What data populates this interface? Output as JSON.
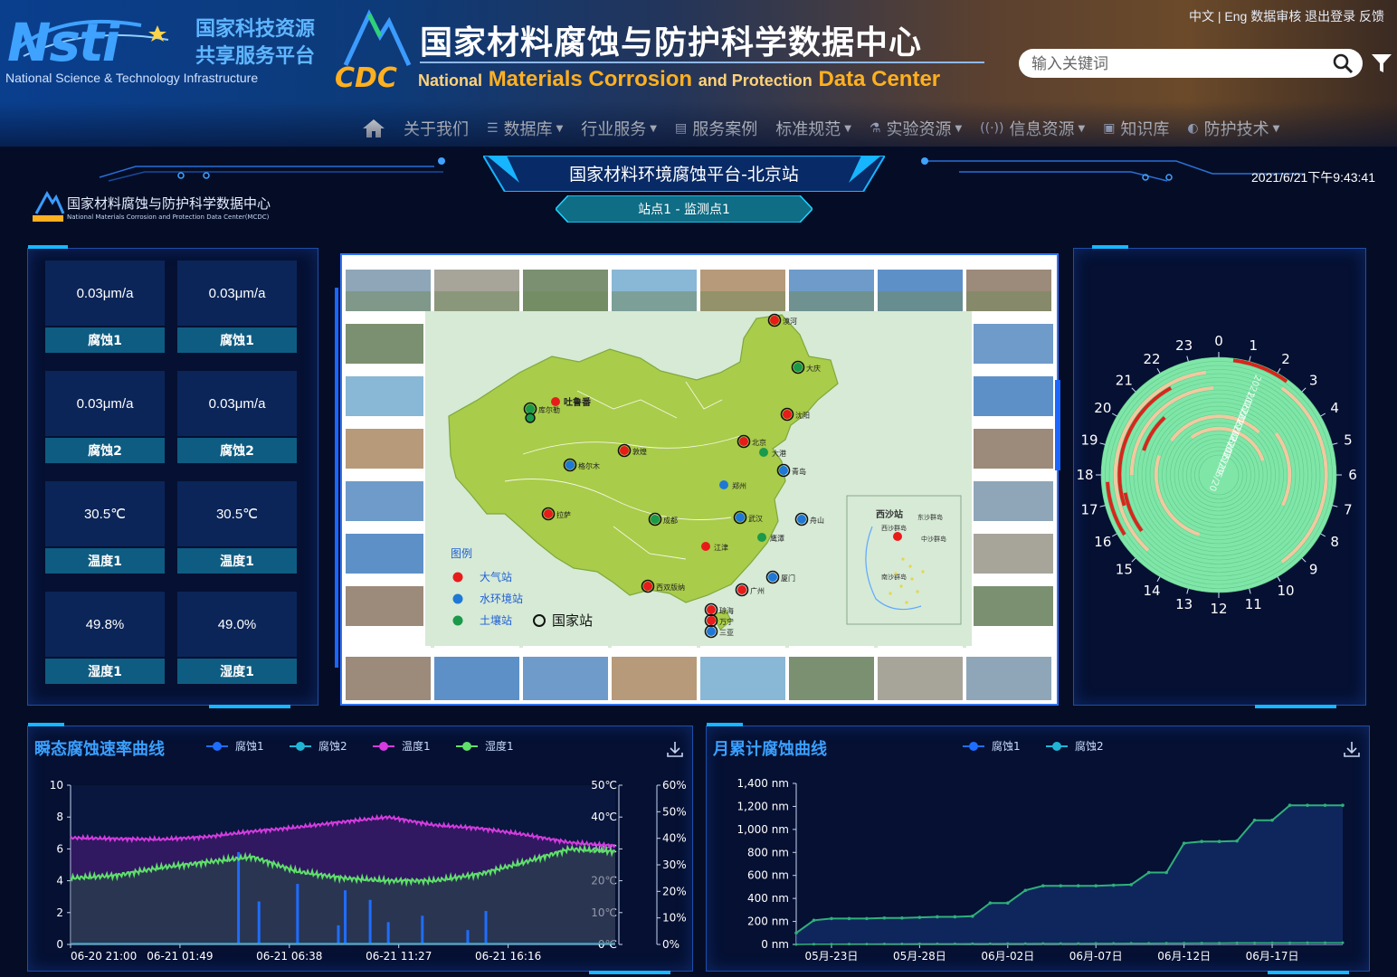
{
  "header": {
    "nsti_logo_text": "Nsti",
    "nsti_subtitle": "National Science & Technology Infrastructure",
    "platform_line1": "国家科技资源",
    "platform_line2": "共享服务平台",
    "cdc_logo_text": "CDC",
    "main_title": "国家材料腐蚀与防护科学数据中心",
    "en_title_1": "National",
    "en_title_2": "Materials Corrosion",
    "en_title_3": "and Protection",
    "en_title_4": "Data Center",
    "top_links": "中文 | Eng 数据审核 退出登录 反馈",
    "search_placeholder": "输入关键词"
  },
  "nav": [
    {
      "label": "关于我们",
      "icon": "",
      "caret": false
    },
    {
      "label": "数据库",
      "icon": "database-icon",
      "caret": true
    },
    {
      "label": "行业服务",
      "icon": "",
      "caret": true
    },
    {
      "label": "服务案例",
      "icon": "list-icon",
      "caret": false
    },
    {
      "label": "标准规范",
      "icon": "",
      "caret": true
    },
    {
      "label": "实验资源",
      "icon": "flask-icon",
      "caret": true
    },
    {
      "label": "信息资源",
      "icon": "broadcast-icon",
      "caret": true
    },
    {
      "label": "知识库",
      "icon": "book-icon",
      "caret": false
    },
    {
      "label": "防护技术",
      "icon": "shield-icon",
      "caret": true
    }
  ],
  "subheader": {
    "platform_title": "国家材料环境腐蚀平台-北京站",
    "station": "站点1 - 监测点1",
    "datetime": "2021/6/21下午9:43:41",
    "brand_cn": "国家材料腐蚀与防护科学数据中心",
    "brand_en": "National Materials Corrosion and Protection Data Center(MCDC)"
  },
  "metrics": [
    {
      "value": "0.03μm/a",
      "label": "腐蚀1"
    },
    {
      "value": "0.03μm/a",
      "label": "腐蚀1"
    },
    {
      "value": "0.03μm/a",
      "label": "腐蚀2"
    },
    {
      "value": "0.03μm/a",
      "label": "腐蚀2"
    },
    {
      "value": "30.5℃",
      "label": "温度1"
    },
    {
      "value": "30.5℃",
      "label": "温度1"
    },
    {
      "value": "49.8%",
      "label": "湿度1"
    },
    {
      "value": "49.0%",
      "label": "湿度1"
    }
  ],
  "map": {
    "legend_title": "图例",
    "legend_air": "大气站",
    "legend_water": "水环境站",
    "legend_soil": "土壤站",
    "legend_national": "国家站",
    "inset_title": "西沙站",
    "inset_labels": [
      "东沙群岛",
      "西沙群岛",
      "中沙群岛",
      "南沙群岛"
    ],
    "stations": [
      {
        "name": "漠河",
        "type": "air",
        "national": true
      },
      {
        "name": "大庆",
        "type": "soil",
        "national": true
      },
      {
        "name": "沈阳",
        "type": "air",
        "national": true
      },
      {
        "name": "北京",
        "type": "air",
        "national": true
      },
      {
        "name": "大港",
        "type": "soil",
        "national": false
      },
      {
        "name": "青岛",
        "type": "water",
        "national": true
      },
      {
        "name": "郑州",
        "type": "water",
        "national": false
      },
      {
        "name": "吐鲁番",
        "type": "air",
        "national": false
      },
      {
        "name": "库尔勒",
        "type": "soil",
        "national": true
      },
      {
        "name": "敦煌",
        "type": "air",
        "national": true
      },
      {
        "name": "格尔木",
        "type": "water",
        "national": true
      },
      {
        "name": "拉萨",
        "type": "air",
        "national": true
      },
      {
        "name": "成都",
        "type": "soil",
        "national": true
      },
      {
        "name": "武汉",
        "type": "water",
        "national": true
      },
      {
        "name": "舟山",
        "type": "water",
        "national": true
      },
      {
        "name": "鹰潭",
        "type": "soil",
        "national": false
      },
      {
        "name": "江津",
        "type": "air",
        "national": false
      },
      {
        "name": "厦门",
        "type": "water",
        "national": true
      },
      {
        "name": "广州",
        "type": "air",
        "national": true
      },
      {
        "name": "西双版纳",
        "type": "air",
        "national": true
      },
      {
        "name": "琼海",
        "type": "air",
        "national": true
      },
      {
        "name": "万宁",
        "type": "air",
        "national": true
      },
      {
        "name": "三亚",
        "type": "water",
        "national": true
      }
    ]
  },
  "radial": {
    "hours": [
      "0",
      "1",
      "2",
      "3",
      "4",
      "5",
      "6",
      "7",
      "8",
      "9",
      "10",
      "11",
      "12",
      "13",
      "14",
      "15",
      "16",
      "17",
      "18",
      "19",
      "20",
      "21",
      "22",
      "23"
    ],
    "date_labels": [
      "2021/06/21",
      "2021/06/12",
      "2021/06/03",
      "2021/05/29",
      "2021/05/20"
    ],
    "colors": {
      "low": "#7fe6a8",
      "mid": "#f2c9a0",
      "high": "#d8261c"
    }
  },
  "chart_left": {
    "title": "瞬态腐蚀速率曲线",
    "legend": [
      {
        "name": "腐蚀1",
        "color": "#1f6dff"
      },
      {
        "name": "腐蚀2",
        "color": "#1fb6d6"
      },
      {
        "name": "温度1",
        "color": "#d53be0"
      },
      {
        "name": "湿度1",
        "color": "#5fe06a"
      }
    ],
    "y_left_ticks": [
      "0",
      "2",
      "4",
      "6",
      "8",
      "10"
    ],
    "y_temp_ticks": [
      "0℃",
      "10℃",
      "20℃",
      "30℃",
      "40℃",
      "50℃"
    ],
    "y_hum_ticks": [
      "0%",
      "10%",
      "20%",
      "30%",
      "40%",
      "50%",
      "60%"
    ],
    "x_ticks": [
      "06-20 21:00",
      "06-21 01:49",
      "06-21 06:38",
      "06-21 11:27",
      "06-21 16:16"
    ]
  },
  "chart_right": {
    "title": "月累计腐蚀曲线",
    "legend": [
      {
        "name": "腐蚀1",
        "color": "#1f6dff"
      },
      {
        "name": "腐蚀2",
        "color": "#1fb6d6"
      }
    ],
    "y_ticks": [
      "0 nm",
      "200 nm",
      "400 nm",
      "600 nm",
      "800 nm",
      "1,000 nm",
      "1,200 nm",
      "1,400 nm"
    ],
    "x_ticks": [
      "05月-23日",
      "05月-28日",
      "06月-02日",
      "06月-07日",
      "06月-12日",
      "06月-17日"
    ]
  },
  "chart_data": [
    {
      "type": "line",
      "title": "瞬态腐蚀速率曲线",
      "x_range": [
        "06-20 21:00",
        "06-21 21:00"
      ],
      "y_left_range": [
        0,
        10
      ],
      "y_temp_range_c": [
        0,
        50
      ],
      "y_hum_range_pct": [
        0,
        60
      ],
      "series": [
        {
          "name": "温度1",
          "axis": "temp",
          "x_hours": [
            0,
            2,
            4,
            6,
            8,
            10,
            12,
            14,
            16,
            18,
            20,
            22,
            24
          ],
          "values": [
            33.5,
            33.2,
            33,
            33.8,
            35.5,
            36.8,
            38.5,
            40,
            37.5,
            36.5,
            34.5,
            32,
            31
          ]
        },
        {
          "name": "湿度1",
          "axis": "humidity",
          "x_hours": [
            0,
            2,
            4,
            6,
            8,
            10,
            12,
            14,
            16,
            18,
            20,
            22,
            24
          ],
          "values": [
            25,
            26,
            29,
            31,
            33,
            27.5,
            25,
            24,
            24,
            26.5,
            31,
            36,
            35
          ]
        },
        {
          "name": "腐蚀1",
          "axis": "left",
          "x_hours": [
            7.4,
            8.3,
            10.0,
            11.8,
            12.1,
            13.2,
            14.0,
            15.5,
            17.5,
            18.3
          ],
          "values": [
            5.8,
            2.7,
            3.8,
            1.2,
            3.4,
            2.8,
            1.4,
            1.8,
            0.9,
            2.1
          ]
        },
        {
          "name": "腐蚀2",
          "axis": "left",
          "x_hours": [
            0,
            24
          ],
          "values": [
            0,
            0
          ]
        }
      ]
    },
    {
      "type": "line",
      "title": "月累计腐蚀曲线",
      "x_range": [
        "05月-21日",
        "06月-21日"
      ],
      "ylim": [
        0,
        1400
      ],
      "categories": [
        "05-21",
        "05-22",
        "05-23",
        "05-24",
        "05-25",
        "05-26",
        "05-27",
        "05-28",
        "05-29",
        "05-30",
        "05-31",
        "06-01",
        "06-02",
        "06-03",
        "06-04",
        "06-05",
        "06-06",
        "06-07",
        "06-08",
        "06-09",
        "06-10",
        "06-11",
        "06-12",
        "06-13",
        "06-14",
        "06-15",
        "06-16",
        "06-17",
        "06-18",
        "06-19",
        "06-20",
        "06-21"
      ],
      "series": [
        {
          "name": "腐蚀1",
          "values": [
            100,
            210,
            225,
            225,
            225,
            230,
            230,
            235,
            240,
            240,
            245,
            360,
            360,
            470,
            510,
            510,
            510,
            510,
            515,
            520,
            625,
            625,
            880,
            895,
            895,
            900,
            1080,
            1080,
            1210,
            1210,
            1210,
            1210
          ]
        },
        {
          "name": "腐蚀2",
          "values": [
            0,
            2,
            2,
            3,
            3,
            4,
            4,
            5,
            5,
            5,
            6,
            6,
            7,
            7,
            8,
            8,
            8,
            9,
            9,
            10,
            10,
            11,
            11,
            12,
            12,
            13,
            13,
            14,
            14,
            15,
            15,
            15
          ]
        }
      ]
    }
  ]
}
